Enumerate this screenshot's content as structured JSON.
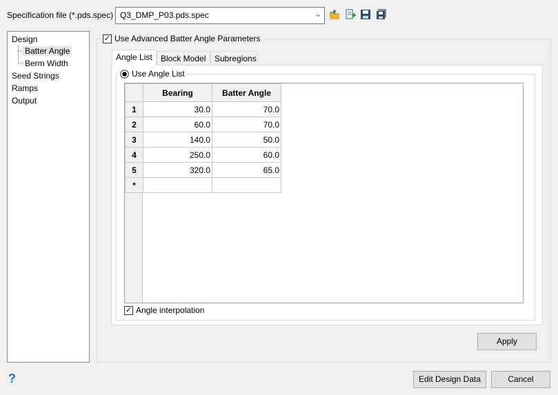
{
  "spec": {
    "label": "Specification file (*.pds.spec)",
    "value": "Q3_DMP_P03.pds.spec"
  },
  "toolbar": [
    "open-folder-icon",
    "new-file-icon",
    "save-icon",
    "save-as-icon"
  ],
  "tree": {
    "design": "Design",
    "batter_angle": "Batter Angle",
    "berm_width": "Berm Width",
    "seed_strings": "Seed Strings",
    "ramps": "Ramps",
    "output": "Output"
  },
  "advanced": {
    "label": "Use Advanced Batter Angle Parameters",
    "checked": true
  },
  "tabs": [
    "Angle List",
    "Block Model",
    "Subregions"
  ],
  "angle_list": {
    "radio": "Use Angle List",
    "columns": [
      "Bearing",
      "Batter Angle"
    ],
    "rows": [
      {
        "n": "1",
        "b": "30.0",
        "a": "70.0"
      },
      {
        "n": "2",
        "b": "60.0",
        "a": "70.0"
      },
      {
        "n": "3",
        "b": "140.0",
        "a": "50.0"
      },
      {
        "n": "4",
        "b": "250.0",
        "a": "60.0"
      },
      {
        "n": "5",
        "b": "320.0",
        "a": "65.0"
      }
    ],
    "new_row": "*",
    "interp": "Angle interpolation"
  },
  "buttons": {
    "apply": "Apply",
    "edit": "Edit Design Data",
    "cancel": "Cancel",
    "help": "?"
  }
}
